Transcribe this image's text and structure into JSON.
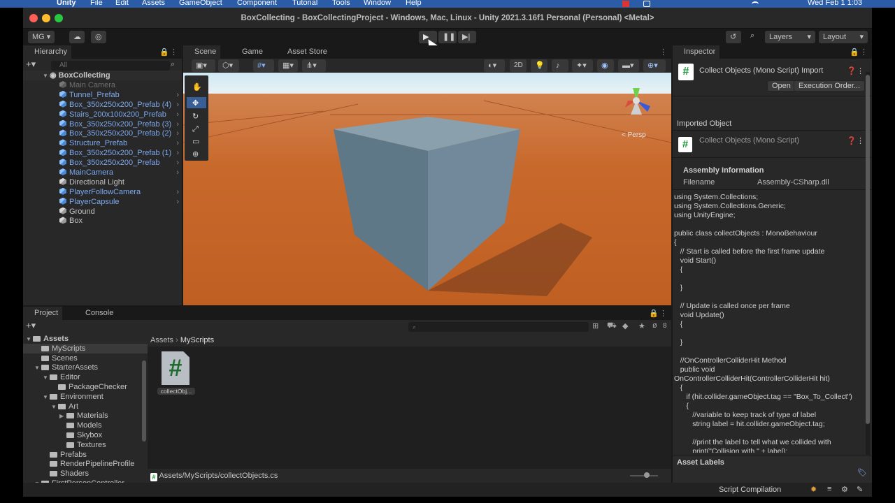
{
  "menubar": {
    "apple": "",
    "app": "Unity",
    "items": [
      "File",
      "Edit",
      "Assets",
      "GameObject",
      "Component",
      "Tutorial",
      "Tools",
      "Window",
      "Help"
    ],
    "clock": "Wed Feb 1  1:03"
  },
  "window": {
    "title": "BoxCollecting - BoxCollectingProject - Windows, Mac, Linux - Unity 2021.3.16f1 Personal (Personal) <Metal>"
  },
  "toolbar": {
    "account": "MG ▾",
    "layers": "Layers",
    "layout": "Layout"
  },
  "hierarchy": {
    "tab": "Hierarchy",
    "search_placeholder": "All",
    "scene": "BoxCollecting",
    "items": [
      {
        "label": "Main Camera",
        "style": "disabled"
      },
      {
        "label": "Tunnel_Prefab",
        "style": "prefab"
      },
      {
        "label": "Box_350x250x200_Prefab (4)",
        "style": "prefab"
      },
      {
        "label": "Stairs_200x100x200_Prefab",
        "style": "prefab"
      },
      {
        "label": "Box_350x250x200_Prefab (3)",
        "style": "prefab"
      },
      {
        "label": "Box_350x250x200_Prefab (2)",
        "style": "prefab"
      },
      {
        "label": "Structure_Prefab",
        "style": "prefab"
      },
      {
        "label": "Box_350x250x200_Prefab (1)",
        "style": "prefab"
      },
      {
        "label": "Box_350x250x200_Prefab",
        "style": "prefab"
      },
      {
        "label": "MainCamera",
        "style": "prefab"
      },
      {
        "label": "Directional Light",
        "style": "object"
      },
      {
        "label": "PlayerFollowCamera",
        "style": "prefab"
      },
      {
        "label": "PlayerCapsule",
        "style": "prefab"
      },
      {
        "label": "Ground",
        "style": "object"
      },
      {
        "label": "Box",
        "style": "object"
      }
    ]
  },
  "scene": {
    "tabs": [
      "Scene",
      "Game",
      "Asset Store"
    ],
    "mode_2d": "2D",
    "persp": "< Persp"
  },
  "inspector": {
    "tab": "Inspector",
    "header_title": "Collect Objects (Mono Script) Import",
    "open_btn": "Open",
    "exec_btn": "Execution Order...",
    "imported_object": "Imported Object",
    "script_title": "Collect Objects (Mono Script)",
    "assembly_info": "Assembly Information",
    "filename_label": "Filename",
    "filename_value": "Assembly-CSharp.dll",
    "code": "using System.Collections;\nusing System.Collections.Generic;\nusing UnityEngine;\n\npublic class collectObjects : MonoBehaviour\n{\n   // Start is called before the first frame update\n   void Start()\n   {\n\n   }\n\n   // Update is called once per frame\n   void Update()\n   {\n\n   }\n\n   //OnControllerColliderHit Method\n   public void\nOnControllerColliderHit(ControllerColliderHit hit)\n   {\n      if (hit.collider.gameObject.tag == \"Box_To_Collect\")\n      {\n         //variable to keep track of type of label\n         string label = hit.collider.gameObject.tag;\n\n         //print the label to tell what we collided with\n         print(\"Collision with \" + label);",
    "asset_labels": "Asset Labels"
  },
  "project": {
    "tabs": [
      "Project",
      "Console"
    ],
    "hidden_count": "8",
    "tree": [
      {
        "label": "Assets",
        "depth": 0,
        "arrow": "▼",
        "bold": true
      },
      {
        "label": "MyScripts",
        "depth": 1,
        "arrow": "",
        "selected": true
      },
      {
        "label": "Scenes",
        "depth": 1,
        "arrow": ""
      },
      {
        "label": "StarterAssets",
        "depth": 1,
        "arrow": "▼"
      },
      {
        "label": "Editor",
        "depth": 2,
        "arrow": "▼"
      },
      {
        "label": "PackageChecker",
        "depth": 3,
        "arrow": ""
      },
      {
        "label": "Environment",
        "depth": 2,
        "arrow": "▼"
      },
      {
        "label": "Art",
        "depth": 3,
        "arrow": "▼"
      },
      {
        "label": "Materials",
        "depth": 4,
        "arrow": "▶"
      },
      {
        "label": "Models",
        "depth": 4,
        "arrow": ""
      },
      {
        "label": "Skybox",
        "depth": 4,
        "arrow": ""
      },
      {
        "label": "Textures",
        "depth": 4,
        "arrow": ""
      },
      {
        "label": "Prefabs",
        "depth": 2,
        "arrow": ""
      },
      {
        "label": "RenderPipelineProfile",
        "depth": 2,
        "arrow": ""
      },
      {
        "label": "Shaders",
        "depth": 2,
        "arrow": ""
      },
      {
        "label": "FirstPersonController",
        "depth": 1,
        "arrow": "▼"
      }
    ],
    "breadcrumb": [
      "Assets",
      "MyScripts"
    ],
    "asset_name": "collectObj...",
    "path": "Assets/MyScripts/collectObjects.cs"
  },
  "statusbar": {
    "text": "Script Compilation"
  },
  "colors": {
    "accent": "#2a5ca8",
    "prefab_text": "#7da8ec",
    "ground": "#c5692c",
    "box": "#6e8898"
  }
}
